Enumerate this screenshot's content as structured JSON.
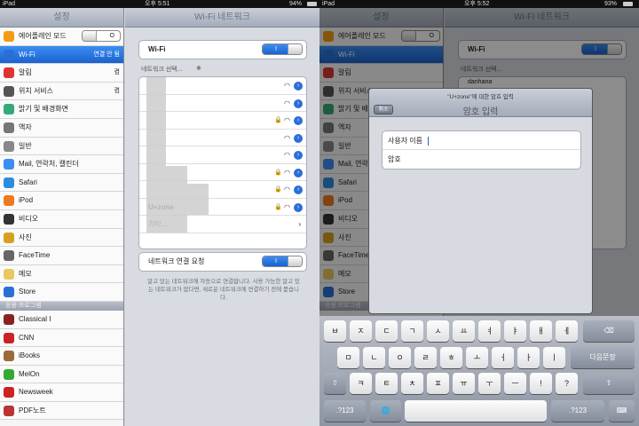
{
  "left": {
    "status": {
      "device": "iPad",
      "time": "오후 5:51",
      "battery": "94%"
    },
    "sidebar": {
      "title": "설정",
      "items": [
        {
          "label": "에어플레인 모드",
          "icon": "airplane-icon",
          "color": "#f39c12",
          "toggle": "off",
          "toggle_text": "O"
        },
        {
          "label": "Wi-Fi",
          "icon": "wifi-icon",
          "color": "#2a6fd6",
          "value": "연결 안 됨",
          "selected": true
        },
        {
          "label": "알림",
          "icon": "notification-icon",
          "color": "#d33",
          "value": "켬"
        },
        {
          "label": "위치 서비스",
          "icon": "location-icon",
          "color": "#555",
          "value": "켬"
        },
        {
          "label": "밝기 및 배경화면",
          "icon": "brightness-icon",
          "color": "#3a7",
          "value": ""
        },
        {
          "label": "액자",
          "icon": "frame-icon",
          "color": "#777",
          "value": ""
        },
        {
          "label": "일반",
          "icon": "gear-icon",
          "color": "#888",
          "value": ""
        },
        {
          "label": "Mail, 연락처, 캘린더",
          "icon": "mail-icon",
          "color": "#3b8df0",
          "value": ""
        },
        {
          "label": "Safari",
          "icon": "safari-icon",
          "color": "#2a8de0",
          "value": ""
        },
        {
          "label": "iPod",
          "icon": "ipod-icon",
          "color": "#f07820",
          "value": ""
        },
        {
          "label": "비디오",
          "icon": "video-icon",
          "color": "#333",
          "value": ""
        },
        {
          "label": "사진",
          "icon": "sunflower-icon",
          "color": "#d8a020",
          "value": ""
        },
        {
          "label": "FaceTime",
          "icon": "facetime-icon",
          "color": "#666",
          "value": ""
        },
        {
          "label": "메모",
          "icon": "notes-icon",
          "color": "#e8c860",
          "value": ""
        },
        {
          "label": "Store",
          "icon": "store-icon",
          "color": "#2a6fd6",
          "value": ""
        }
      ],
      "section_header": "응용 프로그램",
      "apps": [
        {
          "label": "Classical I",
          "icon": "classical-icon",
          "color": "#822"
        },
        {
          "label": "CNN",
          "icon": "cnn-icon",
          "color": "#c22"
        },
        {
          "label": "iBooks",
          "icon": "ibooks-icon",
          "color": "#9a6a3a"
        },
        {
          "label": "MelOn",
          "icon": "melon-icon",
          "color": "#3a3"
        },
        {
          "label": "Newsweek",
          "icon": "newsweek-icon",
          "color": "#c22"
        },
        {
          "label": "PDF노트",
          "icon": "pdf-icon",
          "color": "#b33"
        }
      ]
    },
    "detail": {
      "title": "Wi-Fi 네트워크",
      "wifi_label": "Wi-Fi",
      "toggle_on": "I",
      "choose_network": "네트워크 선택...",
      "network_name": "U+zone",
      "other": "기타...",
      "ask_label": "네트워크 연결 요청",
      "caption": "알고 있는 네트워크에 자동으로 연결합니다. 사용 가능한 알고 있는 네트워크가 없다면, 새로운 네트워크에 연결하기 전에 묻습니다."
    }
  },
  "right": {
    "status": {
      "device": "iPad",
      "time": "오후 5:52",
      "battery": "93%"
    },
    "sidebar_title": "설정",
    "detail_title": "Wi-Fi 네트워크",
    "network_partial": "danhana",
    "modal": {
      "subtitle": "\"U+zone\"에 대한 암호 입력",
      "title": "암호 입력",
      "cancel": "취소",
      "username_label": "사용자 이름",
      "password_label": "암호"
    },
    "keyboard": {
      "row1": [
        "ㅂ",
        "ㅈ",
        "ㄷ",
        "ㄱ",
        "ㅅ",
        "ㅛ",
        "ㅕ",
        "ㅑ",
        "ㅐ",
        "ㅔ"
      ],
      "row2": [
        "ㅁ",
        "ㄴ",
        "ㅇ",
        "ㄹ",
        "ㅎ",
        "ㅗ",
        "ㅓ",
        "ㅏ",
        "ㅣ"
      ],
      "row3": [
        "ㅋ",
        "ㅌ",
        "ㅊ",
        "ㅍ",
        "ㅠ",
        "ㅜ",
        "ㅡ",
        "!",
        "?"
      ],
      "backspace": "⌫",
      "enter": "다음문장",
      "shift": "⇧",
      "numbers": ".?123",
      "globe": "🌐",
      "dismiss": "⌨"
    }
  }
}
